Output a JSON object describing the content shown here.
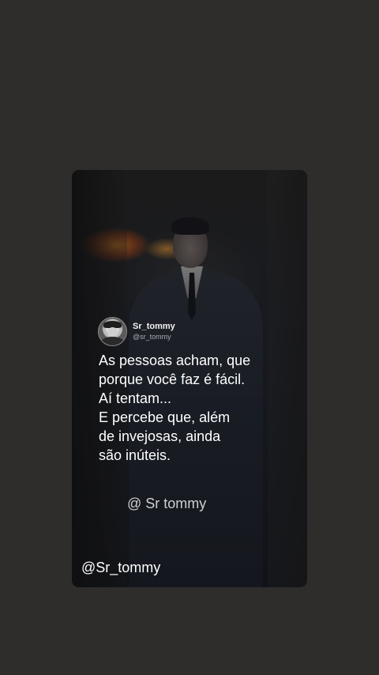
{
  "post": {
    "display_name": "Sr_tommy",
    "handle": "@sr_tommy",
    "quote_lines": [
      "As pessoas acham, que",
      "porque você faz é fácil.",
      "Aí tentam...",
      "E percebe que, além",
      "de invejosas, ainda",
      "são inúteis."
    ],
    "signature": "@ Sr tommy",
    "watermark": "@Sr_tommy"
  },
  "icons": {
    "avatar": "profile-avatar-icon"
  }
}
